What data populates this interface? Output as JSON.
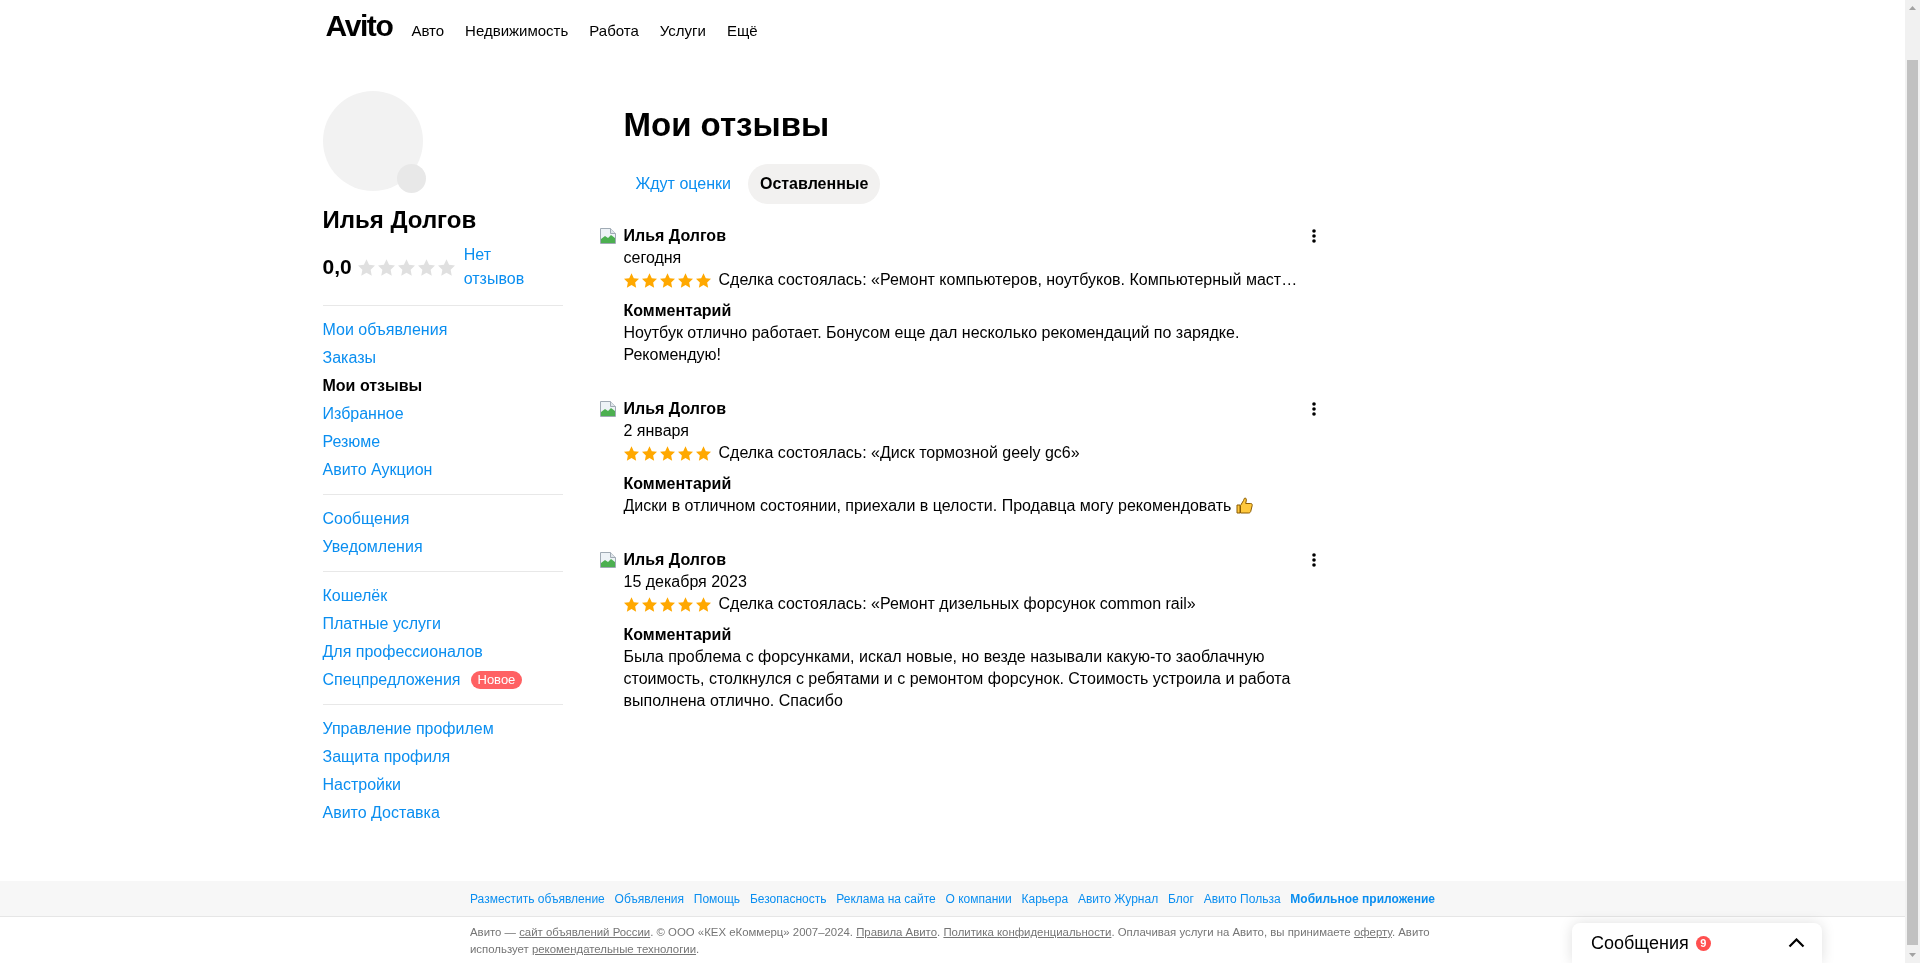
{
  "header": {
    "logo": "Avito",
    "nav": [
      "Авто",
      "Недвижимость",
      "Работа",
      "Услуги",
      "Ещё"
    ]
  },
  "profile": {
    "name": "Илья Долгов",
    "rating": {
      "value": "0,0",
      "stars": 0,
      "reviews_link": "Нет отзывов"
    }
  },
  "sidebar": {
    "groups": [
      {
        "items": [
          {
            "label": "Мои объявления",
            "selected": false
          },
          {
            "label": "Заказы",
            "selected": false
          },
          {
            "label": "Мои отзывы",
            "selected": true
          },
          {
            "label": "Избранное",
            "selected": false
          },
          {
            "label": "Резюме",
            "selected": false
          },
          {
            "label": "Авито Аукцион",
            "selected": false
          }
        ]
      },
      {
        "items": [
          {
            "label": "Сообщения",
            "selected": false
          },
          {
            "label": "Уведомления",
            "selected": false
          }
        ]
      },
      {
        "items": [
          {
            "label": "Кошелёк",
            "selected": false
          },
          {
            "label": "Платные услуги",
            "selected": false
          },
          {
            "label": "Для профессионалов",
            "selected": false
          },
          {
            "label": "Спецпредложения",
            "selected": false,
            "badge": "Новое"
          }
        ]
      },
      {
        "items": [
          {
            "label": "Управление профилем",
            "selected": false
          },
          {
            "label": "Защита профиля",
            "selected": false
          },
          {
            "label": "Настройки",
            "selected": false
          },
          {
            "label": "Авито Доставка",
            "selected": false
          }
        ]
      }
    ]
  },
  "page": {
    "title": "Мои отзывы",
    "tabs": [
      {
        "label": "Ждут оценки",
        "selected": false
      },
      {
        "label": "Оставленные",
        "selected": true
      }
    ]
  },
  "reviews": [
    {
      "author": "Илья Долгов",
      "date": "сегодня",
      "stars": 5,
      "deal": "Сделка состоялась: «Ремонт компьютеров, ноутбуков. Компьютерный маст…",
      "comment_label": "Комментарий",
      "comment": "Ноутбук отлично работает. Бонусом еще дал несколько рекомендаций по зарядке. Рекомендую!",
      "emoji": false
    },
    {
      "author": "Илья Долгов",
      "date": "2 января",
      "stars": 5,
      "deal": "Сделка состоялась: «Диск тормозной geely gc6»",
      "comment_label": "Комментарий",
      "comment": "Диски в отличном состоянии, приехали в целости. Продавца могу рекомендовать",
      "emoji": true
    },
    {
      "author": "Илья Долгов",
      "date": "15 декабря 2023",
      "stars": 5,
      "deal": "Сделка состоялась: «Ремонт дизельных форсунок common rail»",
      "comment_label": "Комментарий",
      "comment": "Была проблема с форсунками, искал новые, но везде называли какую-то заоблачную стоимость, столкнулся с ребятами и с ремонтом форсунок. Стоимость устроила и работа выполнена отлично. Спасибо",
      "emoji": false
    }
  ],
  "footer": {
    "links": [
      {
        "label": "Разместить объявление",
        "emphasized": false
      },
      {
        "label": "Объявления",
        "emphasized": false
      },
      {
        "label": "Помощь",
        "emphasized": false
      },
      {
        "label": "Безопасность",
        "emphasized": false
      },
      {
        "label": "Реклама на сайте",
        "emphasized": false
      },
      {
        "label": "О компании",
        "emphasized": false
      },
      {
        "label": "Карьера",
        "emphasized": false
      },
      {
        "label": "Авито Журнал",
        "emphasized": false
      },
      {
        "label": "Блог",
        "emphasized": false
      },
      {
        "label": "Авито Польза",
        "emphasized": false
      },
      {
        "label": "Мобильное приложение",
        "emphasized": true
      }
    ],
    "legal": [
      {
        "kind": "text",
        "text": "Авито — "
      },
      {
        "kind": "link",
        "text": "сайт объявлений России"
      },
      {
        "kind": "text",
        "text": ". © ООО «КЕХ еКоммерц» 2007–2024. "
      },
      {
        "kind": "link",
        "text": "Правила Авито"
      },
      {
        "kind": "text",
        "text": ". "
      },
      {
        "kind": "link",
        "text": "Политика конфиденциальности"
      },
      {
        "kind": "text",
        "text": ". Оплачивая услуги на Авито, вы принимаете "
      },
      {
        "kind": "link",
        "text": "оферту"
      },
      {
        "kind": "text",
        "text": ". Авито использует "
      },
      {
        "kind": "link",
        "text": "рекомендательные технологии"
      },
      {
        "kind": "text",
        "text": "."
      }
    ]
  },
  "messages_widget": {
    "label": "Сообщения",
    "count": "9",
    "expanded": false
  }
}
